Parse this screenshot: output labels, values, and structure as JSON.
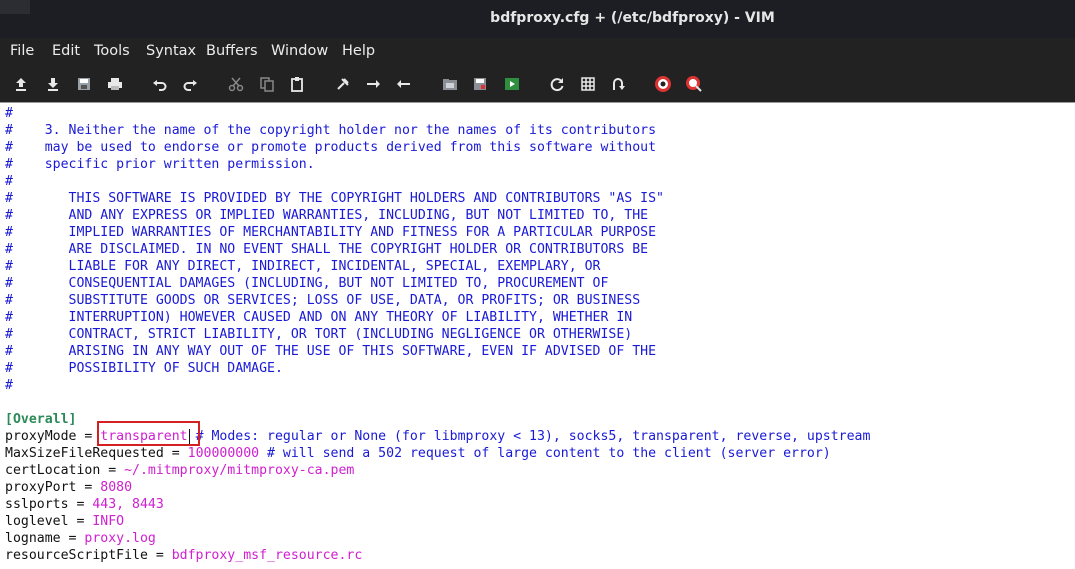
{
  "window": {
    "title": "bdfproxy.cfg + (/etc/bdfproxy) - VIM"
  },
  "menu": [
    "File",
    "Edit",
    "Tools",
    "Syntax",
    "Buffers",
    "Window",
    "Help"
  ],
  "toolbar": {
    "icons": [
      "open-icon",
      "save-icon",
      "save-all-icon",
      "print-icon",
      "undo-icon",
      "redo-icon",
      "cut-icon",
      "copy-icon",
      "paste-icon",
      "find-replace-icon",
      "find-next-icon",
      "find-prev-icon",
      "load-session-icon",
      "save-session-icon",
      "run-script-icon",
      "make-icon",
      "run-ctags-icon",
      "jump-tag-icon",
      "help-icon",
      "find-help-icon"
    ]
  },
  "comment_lines": [
    "#",
    "#    3. Neither the name of the copyright holder nor the names of its contributors",
    "#    may be used to endorse or promote products derived from this software without",
    "#    specific prior written permission.",
    "#",
    "#       THIS SOFTWARE IS PROVIDED BY THE COPYRIGHT HOLDERS AND CONTRIBUTORS \"AS IS\"",
    "#       AND ANY EXPRESS OR IMPLIED WARRANTIES, INCLUDING, BUT NOT LIMITED TO, THE",
    "#       IMPLIED WARRANTIES OF MERCHANTABILITY AND FITNESS FOR A PARTICULAR PURPOSE",
    "#       ARE DISCLAIMED. IN NO EVENT SHALL THE COPYRIGHT HOLDER OR CONTRIBUTORS BE",
    "#       LIABLE FOR ANY DIRECT, INDIRECT, INCIDENTAL, SPECIAL, EXEMPLARY, OR",
    "#       CONSEQUENTIAL DAMAGES (INCLUDING, BUT NOT LIMITED TO, PROCUREMENT OF",
    "#       SUBSTITUTE GOODS OR SERVICES; LOSS OF USE, DATA, OR PROFITS; OR BUSINESS",
    "#       INTERRUPTION) HOWEVER CAUSED AND ON ANY THEORY OF LIABILITY, WHETHER IN",
    "#       CONTRACT, STRICT LIABILITY, OR TORT (INCLUDING NEGLIGENCE OR OTHERWISE)",
    "#       ARISING IN ANY WAY OUT OF THE USE OF THIS SOFTWARE, EVEN IF ADVISED OF THE",
    "#       POSSIBILITY OF SUCH DAMAGE.",
    "#"
  ],
  "section": "[Overall]",
  "config": [
    {
      "key": "proxyMode = ",
      "value": "transparent",
      "comment": " # Modes: regular or None (for libmproxy < 13), socks5, transparent, reverse, upstream"
    },
    {
      "key": "MaxSizeFileRequested = ",
      "value": "100000000",
      "comment": " # will send a 502 request of large content to the client (server error)"
    },
    {
      "key": "certLocation = ",
      "value": "~/.mitmproxy/mitmproxy-ca.pem",
      "comment": ""
    },
    {
      "key": "proxyPort = ",
      "value": "8080",
      "comment": ""
    },
    {
      "key": "sslports = ",
      "value": "443, 8443",
      "comment": ""
    },
    {
      "key": "loglevel = ",
      "value": "INFO",
      "comment": ""
    },
    {
      "key": "logname = ",
      "value": "proxy.log",
      "comment": ""
    },
    {
      "key": "resourceScriptFile = ",
      "value": "bdfproxy_msf_resource.rc",
      "comment": ""
    }
  ],
  "colors": {
    "comment": "#1a1ad6",
    "section": "#2b8a57",
    "value": "#d020d0",
    "highlight": "#d42020"
  }
}
